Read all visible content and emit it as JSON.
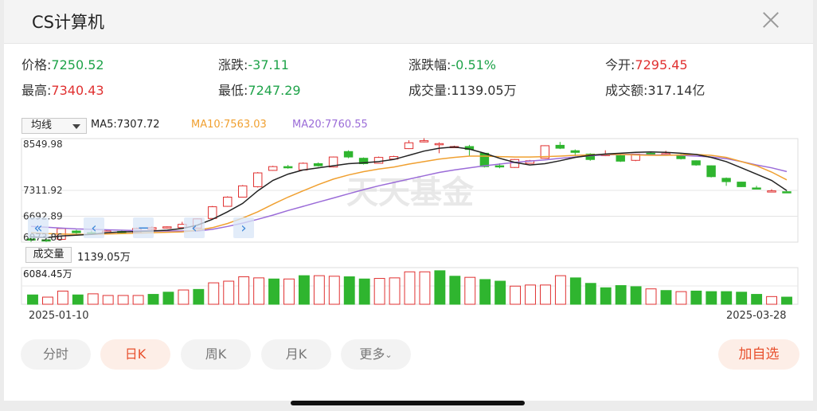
{
  "header": {
    "title": "CS计算机",
    "close_icon": "close-icon"
  },
  "stats": [
    {
      "label": "价格:",
      "value": "7250.52",
      "tone": "green"
    },
    {
      "label": "涨跌:",
      "value": "-37.11",
      "tone": "green"
    },
    {
      "label": "涨跌幅:",
      "value": "-0.51%",
      "tone": "green"
    },
    {
      "label": "今开:",
      "value": "7295.45",
      "tone": "red"
    },
    {
      "label": "最高:",
      "value": "7340.43",
      "tone": "red"
    },
    {
      "label": "最低:",
      "value": "7247.29",
      "tone": "green"
    },
    {
      "label": "成交量:",
      "value": "1139.05万",
      "tone": "plain"
    },
    {
      "label": "成交额:",
      "value": "317.14亿",
      "tone": "plain"
    }
  ],
  "ma": {
    "select_label": "均线",
    "ma5": "MA5:7307.72",
    "ma10": "MA10:7563.03",
    "ma20": "MA20:7760.55",
    "colors": {
      "ma5": "#222222",
      "ma10": "#f0a030",
      "ma20": "#9b6cd8"
    }
  },
  "volume": {
    "label": "成交量",
    "value": "1139.05万",
    "max_label": "6084.45万"
  },
  "dates": {
    "start": "2025-01-10",
    "end": "2025-03-28"
  },
  "tabs": [
    {
      "label": "分时",
      "active": false
    },
    {
      "label": "日K",
      "active": true
    },
    {
      "label": "周K",
      "active": false
    },
    {
      "label": "月K",
      "active": false
    },
    {
      "label": "更多",
      "active": false
    }
  ],
  "add_button": "加自选",
  "watermark": "天天基金",
  "colors": {
    "up": "#e03131",
    "down": "#2fb52f",
    "accent": "#e8512e"
  },
  "chart_data": {
    "type": "candlestick",
    "y_ticks": [
      "8549.98",
      "7311.92",
      "6692.89",
      "6073.86"
    ],
    "ylim": [
      6073.86,
      8549.98
    ],
    "x_range": [
      "2025-01-10",
      "2025-03-28"
    ],
    "candles": [
      {
        "o": 6150,
        "c": 6120,
        "h": 6230,
        "l": 6080
      },
      {
        "o": 6130,
        "c": 6100,
        "h": 6180,
        "l": 6080
      },
      {
        "o": 6140,
        "c": 6400,
        "h": 6420,
        "l": 6120
      },
      {
        "o": 6340,
        "c": 6300,
        "h": 6370,
        "l": 6270
      },
      {
        "o": 6300,
        "c": 6280,
        "h": 6350,
        "l": 6260
      },
      {
        "o": 6300,
        "c": 6340,
        "h": 6360,
        "l": 6260
      },
      {
        "o": 6330,
        "c": 6300,
        "h": 6350,
        "l": 6280
      },
      {
        "o": 6300,
        "c": 6400,
        "h": 6420,
        "l": 6290
      },
      {
        "o": 6380,
        "c": 6420,
        "h": 6450,
        "l": 6360
      },
      {
        "o": 6420,
        "c": 6440,
        "h": 6450,
        "l": 6400
      },
      {
        "o": 6420,
        "c": 6500,
        "h": 6560,
        "l": 6420
      },
      {
        "o": 6410,
        "c": 6630,
        "h": 6640,
        "l": 6400
      },
      {
        "o": 6640,
        "c": 6920,
        "h": 6940,
        "l": 6630
      },
      {
        "o": 6930,
        "c": 7150,
        "h": 7170,
        "l": 6920
      },
      {
        "o": 7150,
        "c": 7420,
        "h": 7440,
        "l": 7150
      },
      {
        "o": 7400,
        "c": 7730,
        "h": 7750,
        "l": 7380
      },
      {
        "o": 7790,
        "c": 7880,
        "h": 7900,
        "l": 7780
      },
      {
        "o": 7880,
        "c": 7850,
        "h": 7920,
        "l": 7830
      },
      {
        "o": 7800,
        "c": 7960,
        "h": 7980,
        "l": 7790
      },
      {
        "o": 7950,
        "c": 7900,
        "h": 7980,
        "l": 7880
      },
      {
        "o": 7870,
        "c": 8110,
        "h": 8120,
        "l": 7860
      },
      {
        "o": 8240,
        "c": 8110,
        "h": 8270,
        "l": 8080
      },
      {
        "o": 8080,
        "c": 7950,
        "h": 8100,
        "l": 7930
      },
      {
        "o": 7960,
        "c": 8100,
        "h": 8120,
        "l": 7950
      },
      {
        "o": 8060,
        "c": 8120,
        "h": 8140,
        "l": 8050
      },
      {
        "o": 8310,
        "c": 8450,
        "h": 8510,
        "l": 8300
      },
      {
        "o": 8470,
        "c": 8500,
        "h": 8560,
        "l": 8460
      },
      {
        "o": 8420,
        "c": 8430,
        "h": 8460,
        "l": 8200
      },
      {
        "o": 8340,
        "c": 8360,
        "h": 8380,
        "l": 8330
      },
      {
        "o": 8360,
        "c": 8290,
        "h": 8400,
        "l": 8130
      },
      {
        "o": 8200,
        "c": 7880,
        "h": 8210,
        "l": 7860
      },
      {
        "o": 7900,
        "c": 7890,
        "h": 7960,
        "l": 7840
      },
      {
        "o": 7860,
        "c": 8050,
        "h": 8060,
        "l": 7850
      },
      {
        "o": 7960,
        "c": 8020,
        "h": 8040,
        "l": 7950
      },
      {
        "o": 8080,
        "c": 8380,
        "h": 8390,
        "l": 8070
      },
      {
        "o": 8390,
        "c": 8320,
        "h": 8470,
        "l": 8300
      },
      {
        "o": 8260,
        "c": 8220,
        "h": 8290,
        "l": 8130
      },
      {
        "o": 8180,
        "c": 8050,
        "h": 8200,
        "l": 8020
      },
      {
        "o": 8150,
        "c": 8170,
        "h": 8270,
        "l": 8130
      },
      {
        "o": 8140,
        "c": 8010,
        "h": 8160,
        "l": 7990
      },
      {
        "o": 8030,
        "c": 8180,
        "h": 8190,
        "l": 8010
      },
      {
        "o": 8200,
        "c": 8180,
        "h": 8230,
        "l": 8150
      },
      {
        "o": 8180,
        "c": 8190,
        "h": 8260,
        "l": 8170
      },
      {
        "o": 8160,
        "c": 8070,
        "h": 8180,
        "l": 8050
      },
      {
        "o": 8020,
        "c": 7920,
        "h": 8030,
        "l": 7900
      },
      {
        "o": 7900,
        "c": 7640,
        "h": 7910,
        "l": 7620
      },
      {
        "o": 7600,
        "c": 7520,
        "h": 7620,
        "l": 7420
      },
      {
        "o": 7510,
        "c": 7400,
        "h": 7520,
        "l": 7390
      },
      {
        "o": 7370,
        "c": 7360,
        "h": 7420,
        "l": 7340
      },
      {
        "o": 7295.45,
        "c": 7300,
        "h": 7340,
        "l": 7280
      },
      {
        "o": 7280,
        "c": 7250.52,
        "h": 7300,
        "l": 7247.29
      }
    ],
    "volumes": [
      {
        "v": 1700,
        "up": false
      },
      {
        "v": 1300,
        "up": true
      },
      {
        "v": 2400,
        "up": true
      },
      {
        "v": 1700,
        "up": false
      },
      {
        "v": 1900,
        "up": true
      },
      {
        "v": 1600,
        "up": true
      },
      {
        "v": 1600,
        "up": true
      },
      {
        "v": 1600,
        "up": true
      },
      {
        "v": 1800,
        "up": false
      },
      {
        "v": 2200,
        "up": false
      },
      {
        "v": 2600,
        "up": true
      },
      {
        "v": 2700,
        "up": false
      },
      {
        "v": 3900,
        "up": true
      },
      {
        "v": 4200,
        "up": true
      },
      {
        "v": 5000,
        "up": true
      },
      {
        "v": 4800,
        "up": true
      },
      {
        "v": 4600,
        "up": false
      },
      {
        "v": 4600,
        "up": true
      },
      {
        "v": 5200,
        "up": false
      },
      {
        "v": 5200,
        "up": true
      },
      {
        "v": 5100,
        "up": true
      },
      {
        "v": 5000,
        "up": false
      },
      {
        "v": 4600,
        "up": false
      },
      {
        "v": 4700,
        "up": true
      },
      {
        "v": 4800,
        "up": true
      },
      {
        "v": 5900,
        "up": true
      },
      {
        "v": 5900,
        "up": true
      },
      {
        "v": 6100,
        "up": false
      },
      {
        "v": 5100,
        "up": false
      },
      {
        "v": 4900,
        "up": true
      },
      {
        "v": 4500,
        "up": false
      },
      {
        "v": 4200,
        "up": false
      },
      {
        "v": 3300,
        "up": true
      },
      {
        "v": 3500,
        "up": true
      },
      {
        "v": 3500,
        "up": true
      },
      {
        "v": 5200,
        "up": true
      },
      {
        "v": 4800,
        "up": false
      },
      {
        "v": 3800,
        "up": false
      },
      {
        "v": 3000,
        "up": false
      },
      {
        "v": 3400,
        "up": false
      },
      {
        "v": 3200,
        "up": false
      },
      {
        "v": 2800,
        "up": true
      },
      {
        "v": 2500,
        "up": false
      },
      {
        "v": 2300,
        "up": true
      },
      {
        "v": 2400,
        "up": false
      },
      {
        "v": 2300,
        "up": false
      },
      {
        "v": 2300,
        "up": false
      },
      {
        "v": 2200,
        "up": false
      },
      {
        "v": 1800,
        "up": false
      },
      {
        "v": 1400,
        "up": true
      },
      {
        "v": 1300,
        "up": false
      }
    ],
    "ma5": [
      6200,
      6180,
      6220,
      6240,
      6260,
      6300,
      6320,
      6330,
      6340,
      6360,
      6400,
      6480,
      6620,
      6800,
      7000,
      7300,
      7550,
      7700,
      7800,
      7850,
      7900,
      7950,
      7970,
      8000,
      8050,
      8150,
      8250,
      8320,
      8350,
      8300,
      8200,
      8080,
      7980,
      7920,
      7950,
      8020,
      8100,
      8150,
      8180,
      8200,
      8220,
      8230,
      8220,
      8200,
      8170,
      8100,
      8000,
      7850,
      7700,
      7550,
      7307.72
    ],
    "ma10": [
      6300,
      6280,
      6270,
      6260,
      6260,
      6270,
      6280,
      6290,
      6300,
      6310,
      6320,
      6360,
      6420,
      6520,
      6650,
      6800,
      6980,
      7150,
      7300,
      7450,
      7580,
      7680,
      7760,
      7820,
      7870,
      7940,
      8000,
      8060,
      8100,
      8130,
      8130,
      8120,
      8110,
      8110,
      8120,
      8130,
      8150,
      8160,
      8170,
      8170,
      8160,
      8150,
      8150,
      8160,
      8170,
      8150,
      8100,
      8000,
      7900,
      7750,
      7563.03
    ],
    "ma20": [
      6450,
      6430,
      6410,
      6390,
      6380,
      6370,
      6360,
      6350,
      6340,
      6340,
      6340,
      6340,
      6380,
      6450,
      6530,
      6620,
      6720,
      6830,
      6930,
      7030,
      7130,
      7230,
      7330,
      7420,
      7500,
      7580,
      7660,
      7740,
      7800,
      7850,
      7900,
      7940,
      7980,
      8010,
      8040,
      8080,
      8110,
      8140,
      8160,
      8170,
      8170,
      8160,
      8160,
      8150,
      8130,
      8110,
      8070,
      8000,
      7920,
      7850,
      7760.55
    ]
  }
}
